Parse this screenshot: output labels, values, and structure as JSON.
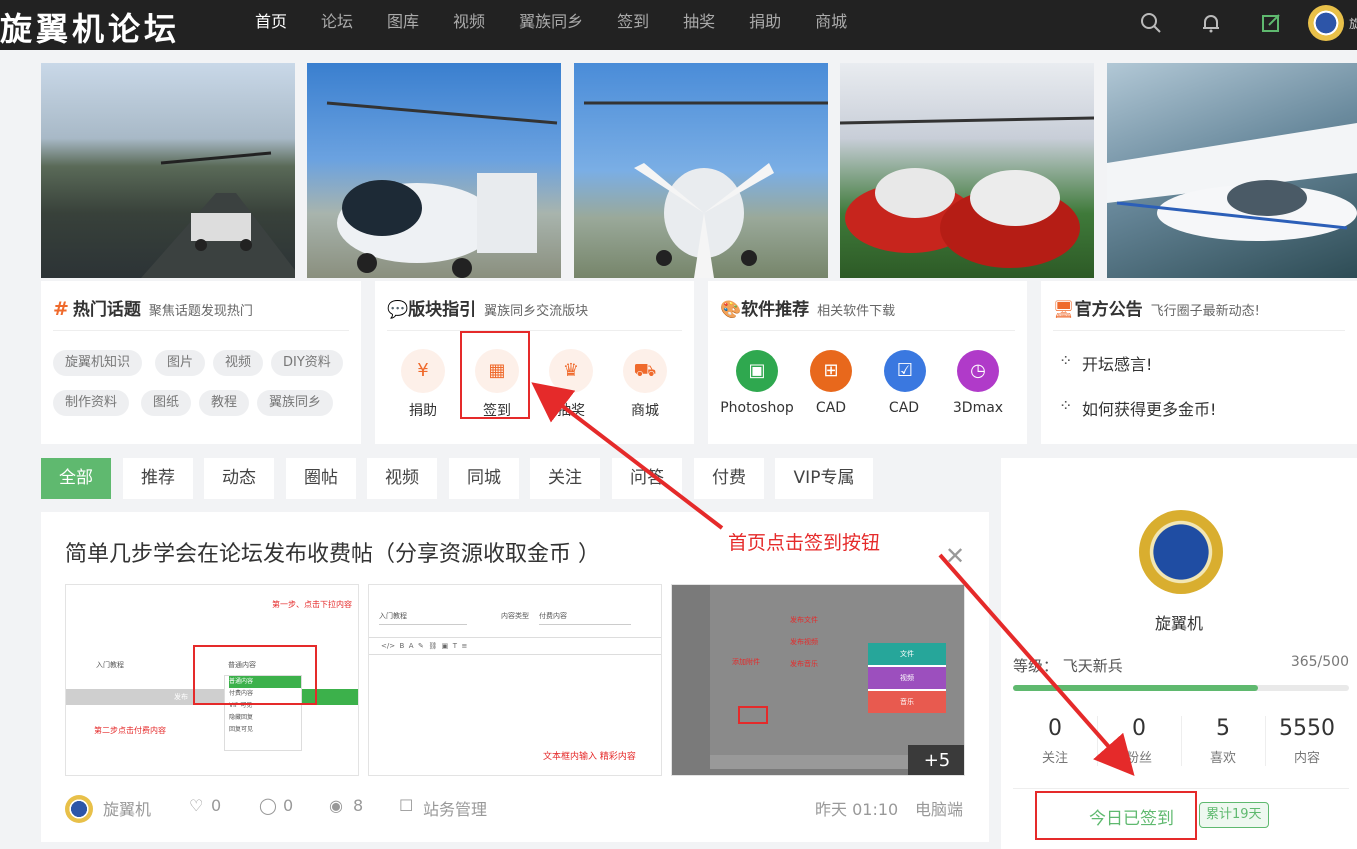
{
  "header": {
    "logo": "旋翼机论坛",
    "nav": [
      "首页",
      "论坛",
      "图库",
      "视频",
      "翼族同乡",
      "签到",
      "抽奖",
      "捐助",
      "商城"
    ],
    "user_text": "旋"
  },
  "hot_topics": {
    "title": "热门话题",
    "subtitle": "聚焦话题发现热门",
    "tags": [
      "旋翼机知识",
      "图片",
      "视频",
      "DIY资料",
      "制作资料",
      "图纸",
      "教程",
      "翼族同乡"
    ]
  },
  "sections": {
    "title": "版块指引",
    "subtitle": "翼族同乡交流版块",
    "items": [
      {
        "label": "捐助",
        "icon": "yen-icon",
        "glyph": "¥"
      },
      {
        "label": "签到",
        "icon": "calendar-icon",
        "glyph": "▦"
      },
      {
        "label": "抽奖",
        "icon": "trophy-icon",
        "glyph": "♛"
      },
      {
        "label": "商城",
        "icon": "cart-icon",
        "glyph": "⛟"
      }
    ]
  },
  "software": {
    "title": "软件推荐",
    "subtitle": "相关软件下载",
    "items": [
      {
        "label": "Photoshop",
        "color": "#2fa84f",
        "glyph": "▣"
      },
      {
        "label": "CAD",
        "color": "#e8681c",
        "glyph": "⊞"
      },
      {
        "label": "CAD",
        "color": "#3a78e0",
        "glyph": "☑"
      },
      {
        "label": "3Dmax",
        "color": "#b03ac9",
        "glyph": "◷"
      }
    ]
  },
  "announcements": {
    "title": "官方公告",
    "subtitle": "飞行圈子最新动态!",
    "items": [
      "开坛感言!",
      "如何获得更多金币!"
    ]
  },
  "filters": [
    "全部",
    "推荐",
    "动态",
    "圈帖",
    "视频",
    "同城",
    "关注",
    "问答",
    "付费",
    "VIP专属"
  ],
  "post": {
    "title": "简单几步学会在论坛发布收费帖（分享资源收取金币 ）",
    "author": "旋翼机",
    "likes": "0",
    "comments": "0",
    "views": "8",
    "category": "站务管理",
    "time": "昨天 01:10",
    "platform": "电脑端",
    "thumb1": {
      "step1": "第一步、点击下拉内容",
      "step2": "第二步点击付费内容",
      "field_a": "入门教程",
      "field_b": "普通内容",
      "options": [
        "普通内容",
        "付费内容",
        "VIP 可见",
        "隐藏回复",
        "回复可见"
      ],
      "publish": "发布"
    },
    "thumb2": {
      "field_a": "入门教程",
      "field_b": "付费内容",
      "label_type": "内容类型",
      "note": "文本框内输入 精彩内容"
    },
    "thumb3": {
      "labels": [
        "发布文件",
        "发布视频",
        "发布音乐",
        "添加附件"
      ],
      "menu": [
        "文件",
        "视频",
        "音乐"
      ],
      "more": "+5"
    }
  },
  "profile": {
    "name": "旋翼机",
    "level_label": "等级",
    "level": "飞天新兵",
    "exp": "365/500",
    "exp_ratio": 0.73,
    "stats": [
      {
        "num": "0",
        "label": "关注"
      },
      {
        "num": "0",
        "label": "粉丝"
      },
      {
        "num": "5",
        "label": "喜欢"
      },
      {
        "num": "5550",
        "label": "内容"
      }
    ],
    "signed": "今日已签到",
    "streak": "累计19天"
  },
  "annotation": {
    "text": "首页点击签到按钮"
  },
  "colors": {
    "accent_green": "#5fb96f",
    "accent_orange": "#ef6a2c",
    "annotation_red": "#e52a2a"
  }
}
